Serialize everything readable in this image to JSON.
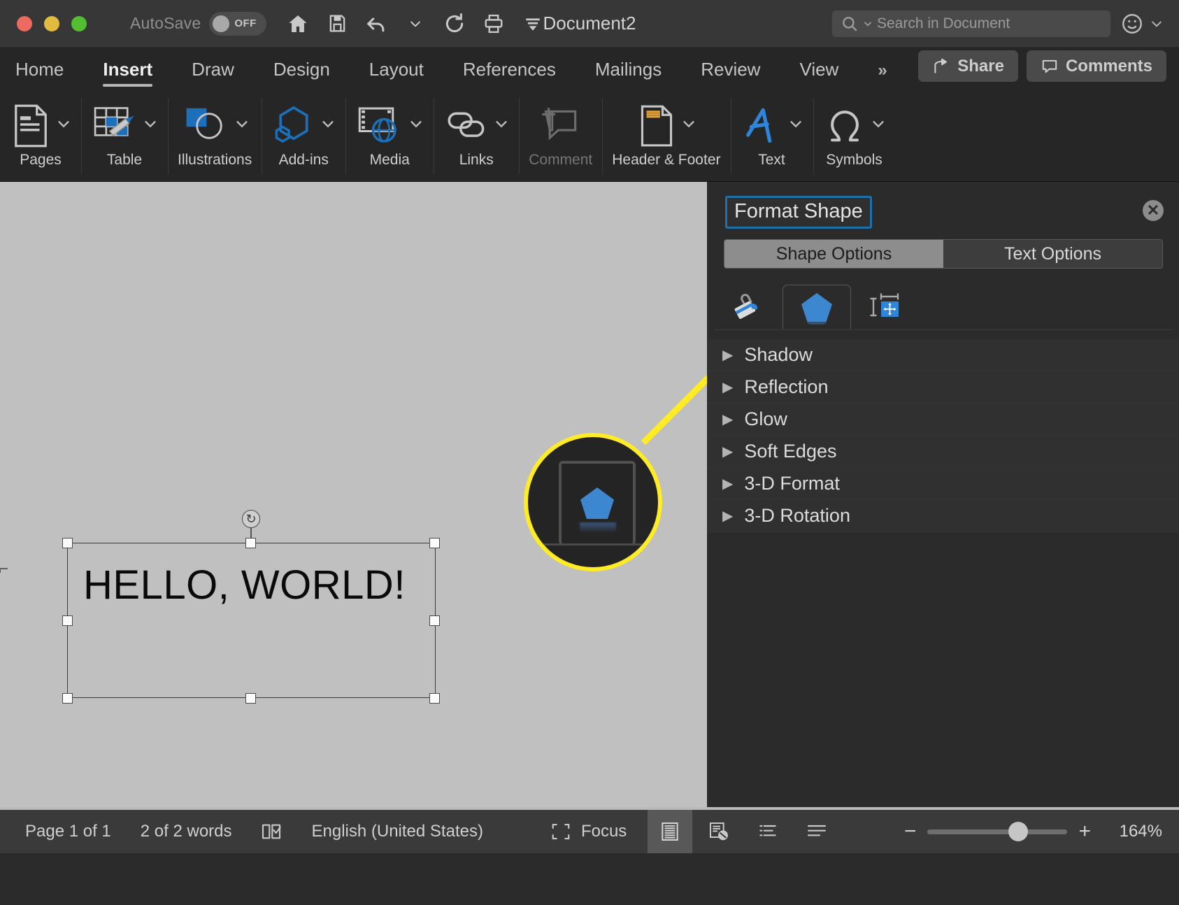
{
  "titlebar": {
    "autosave_label": "AutoSave",
    "autosave_state": "OFF",
    "document_title": "Document2",
    "quick_access": [
      {
        "name": "home-icon",
        "label": "Home"
      },
      {
        "name": "save-icon",
        "label": "Save"
      },
      {
        "name": "undo-icon",
        "label": "Undo"
      },
      {
        "name": "undo-dropdown-icon",
        "label": "Undo options"
      },
      {
        "name": "redo-icon",
        "label": "Redo"
      },
      {
        "name": "print-icon",
        "label": "Print"
      },
      {
        "name": "customize-toolbar-icon",
        "label": "Customize Toolbar"
      }
    ],
    "search_placeholder": "Search in Document",
    "emoji_label": ""
  },
  "ribbon": {
    "tabs": [
      {
        "label": "Home",
        "active": false
      },
      {
        "label": "Insert",
        "active": true
      },
      {
        "label": "Draw",
        "active": false
      },
      {
        "label": "Design",
        "active": false
      },
      {
        "label": "Layout",
        "active": false
      },
      {
        "label": "References",
        "active": false
      },
      {
        "label": "Mailings",
        "active": false
      },
      {
        "label": "Review",
        "active": false
      },
      {
        "label": "View",
        "active": false
      }
    ],
    "overflow_label": "»",
    "share_label": "Share",
    "comments_label": "Comments",
    "groups": [
      {
        "label": "Pages",
        "icon": "pages-icon",
        "dimmed": false
      },
      {
        "label": "Table",
        "icon": "table-icon",
        "dimmed": false
      },
      {
        "label": "Illustrations",
        "icon": "illustrations-icon",
        "dimmed": false
      },
      {
        "label": "Add-ins",
        "icon": "addins-icon",
        "dimmed": false
      },
      {
        "label": "Media",
        "icon": "media-icon",
        "dimmed": false
      },
      {
        "label": "Links",
        "icon": "links-icon",
        "dimmed": false
      },
      {
        "label": "Comment",
        "icon": "comment-icon",
        "dimmed": true
      },
      {
        "label": "Header & Footer",
        "icon": "header-footer-icon",
        "dimmed": false
      },
      {
        "label": "Text",
        "icon": "text-icon",
        "dimmed": false
      },
      {
        "label": "Symbols",
        "icon": "symbols-icon",
        "dimmed": false
      }
    ]
  },
  "document": {
    "textbox_text": "HELLO, WORLD!"
  },
  "panel": {
    "title": "Format Shape",
    "close_label": "✕",
    "segments": [
      {
        "label": "Shape Options",
        "selected": true
      },
      {
        "label": "Text Options",
        "selected": false
      }
    ],
    "icon_tabs": [
      {
        "name": "fill-and-line-icon",
        "selected": false
      },
      {
        "name": "effects-pentagon-icon",
        "selected": true
      },
      {
        "name": "size-and-properties-icon",
        "selected": false
      }
    ],
    "sections": [
      {
        "label": "Shadow",
        "expanded": false
      },
      {
        "label": "Reflection",
        "expanded": false
      },
      {
        "label": "Glow",
        "expanded": false
      },
      {
        "label": "Soft Edges",
        "expanded": false
      },
      {
        "label": "3-D Format",
        "expanded": false
      },
      {
        "label": "3-D Rotation",
        "expanded": false
      }
    ]
  },
  "statusbar": {
    "page_label": "Page 1 of 1",
    "words_label": "2 of 2 words",
    "proofing_icon": "spell-check-icon",
    "language_label": "English (United States)",
    "focus_label": "Focus",
    "view_buttons": [
      {
        "name": "print-layout-view-icon",
        "active": true
      },
      {
        "name": "web-layout-view-icon",
        "active": false
      },
      {
        "name": "outline-view-icon",
        "active": false
      },
      {
        "name": "draft-view-icon",
        "active": false
      }
    ],
    "zoom_minus": "−",
    "zoom_plus": "+",
    "zoom_level": "164%"
  },
  "callout": {
    "highlight_color": "#ffec25",
    "target": "effects-pentagon-icon"
  }
}
